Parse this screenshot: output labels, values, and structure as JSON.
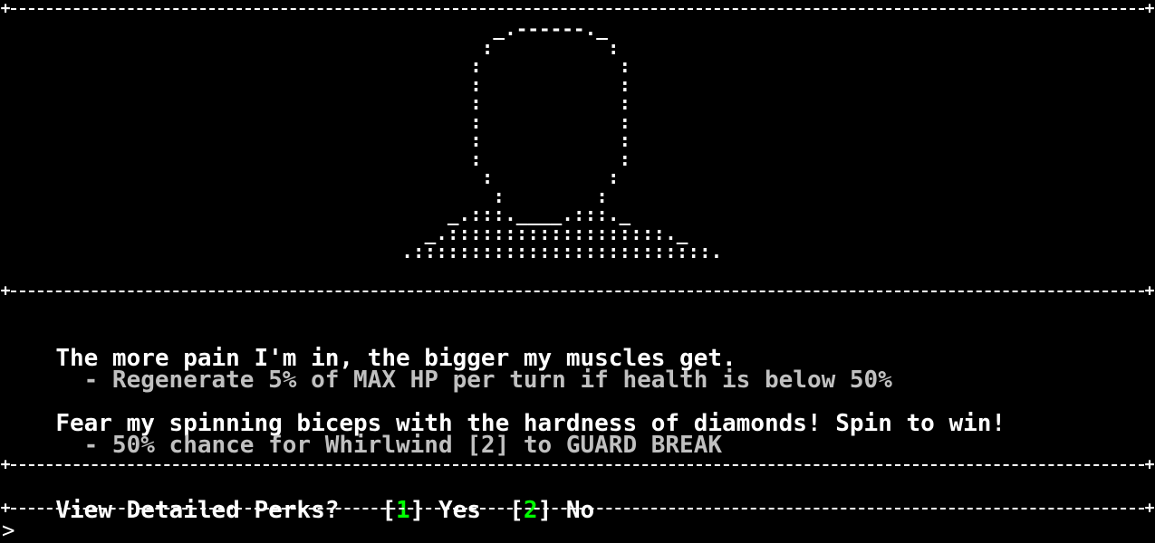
{
  "portrait_ascii": "          _.------._\n         :          :\n        :            :\n        :            :\n        :            :\n        :            :\n        :            :\n        :            :\n         :          :\n          :        :\n      _.:::.____.:::._\n    _.:::::::::::::::::::._\n  .::::::::::::::::::::::::::.",
  "perks": [
    {
      "flavor": "The more pain I'm in, the bigger my muscles get.",
      "effect": "  - Regenerate 5% of MAX HP per turn if health is below 50%"
    },
    {
      "flavor": "Fear my spinning biceps with the hardness of diamonds! Spin to win!",
      "effect": "  - 50% chance for Whirlwind [2] to GUARD BREAK"
    }
  ],
  "prompt": {
    "question": "View Detailed Perks?",
    "option1_key": "1",
    "option1_label": "Yes",
    "option2_key": "2",
    "option2_label": "No"
  },
  "input_cursor": ">",
  "colors": {
    "background": "#000000",
    "text": "#ffffff",
    "effect_text": "#c0c0c0",
    "key_highlight": "#00ff00"
  }
}
